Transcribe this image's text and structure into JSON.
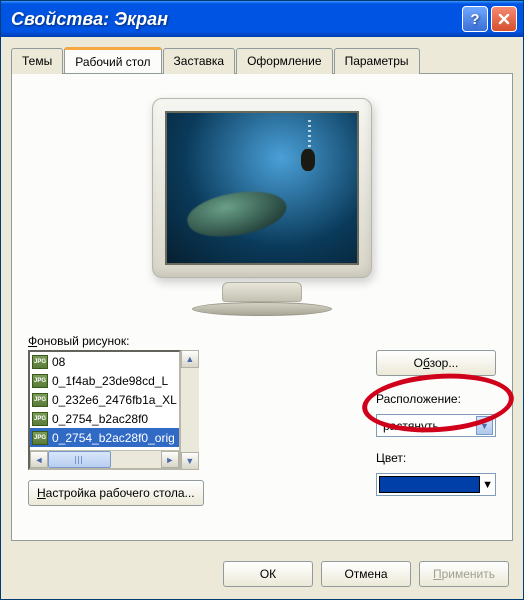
{
  "window": {
    "title": "Свойства: Экран"
  },
  "tabs": {
    "themes": "Темы",
    "desktop": "Рабочий стол",
    "screensaver": "Заставка",
    "appearance": "Оформление",
    "settings": "Параметры"
  },
  "background": {
    "label_prefix": "Ф",
    "label_rest": "оновый рисунок:",
    "items": [
      "08",
      "0_1f4ab_23de98cd_L",
      "0_232e6_2476fb1a_XL",
      "0_2754_b2ac28f0",
      "0_2754_b2ac28f0_orig"
    ],
    "selected_index": 4
  },
  "buttons": {
    "browse": "Обзор...",
    "customize": "Настройка рабочего стола...",
    "ok": "ОК",
    "cancel": "Отмена",
    "apply": "Применить"
  },
  "position": {
    "label": "Расположение:",
    "value": "растянуть"
  },
  "color": {
    "label": "Цвет:",
    "value": "#003ea8"
  },
  "iconbadge": "JPG"
}
